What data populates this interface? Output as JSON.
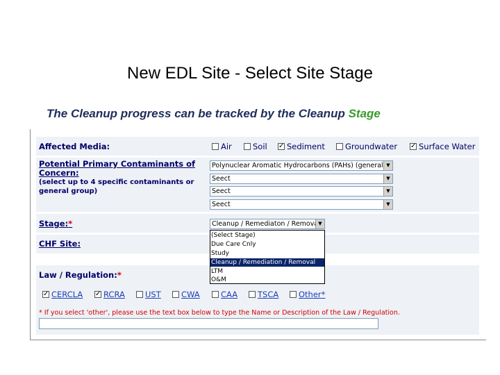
{
  "page": {
    "title": "New EDL Site - Select Site Stage",
    "subtitle_main": "The Cleanup progress can be tracked by the Cleanup ",
    "subtitle_accent": "Stage"
  },
  "colors": {
    "label": "#000066",
    "required": "#cc0000",
    "accent": "#3a9b2b",
    "highlight": "#0a246a"
  },
  "form": {
    "affected_media": {
      "label": "Affected Media:",
      "options": [
        {
          "label": "Air",
          "checked": false
        },
        {
          "label": "Soil",
          "checked": false
        },
        {
          "label": "Sediment",
          "checked": true
        },
        {
          "label": "Groundwater",
          "checked": false
        },
        {
          "label": "Surface Water",
          "checked": true
        }
      ]
    },
    "contaminants": {
      "label_line1": "Potential Primary Contaminants of",
      "label_line2": "Concern:",
      "hint_line1": "(select up to 4 specific contaminants or",
      "hint_line2": "general group)",
      "selects": [
        "Polynuclear Aromatic Hydrocarbons (PAHs) (general)",
        "Seect",
        "Seect",
        "Seect"
      ]
    },
    "stage": {
      "label": "Stage:",
      "required_mark": "*",
      "selected": "Cleanup / Remediaton / Removal",
      "options": [
        "(Select Stage)",
        "Due Care Cnly",
        "Study",
        "Cleanup / Remediation / Removal",
        "LTM",
        "O&M"
      ],
      "highlighted_index": 3
    },
    "chf_site": {
      "label": "CHF Site:"
    },
    "law": {
      "label": "Law / Regulation:",
      "required_mark": "*",
      "options": [
        {
          "label": "CERCLA",
          "checked": true
        },
        {
          "label": "RCRA",
          "checked": true
        },
        {
          "label": "UST",
          "checked": false
        },
        {
          "label": "CWA",
          "checked": false
        },
        {
          "label": "CAA",
          "checked": false
        },
        {
          "label": "TSCA",
          "checked": false
        },
        {
          "label": "Other*",
          "checked": false
        }
      ],
      "note": "* If you select 'other', please use the text box below to type the Name or Description of the Law / Regulation.",
      "other_value": ""
    }
  }
}
